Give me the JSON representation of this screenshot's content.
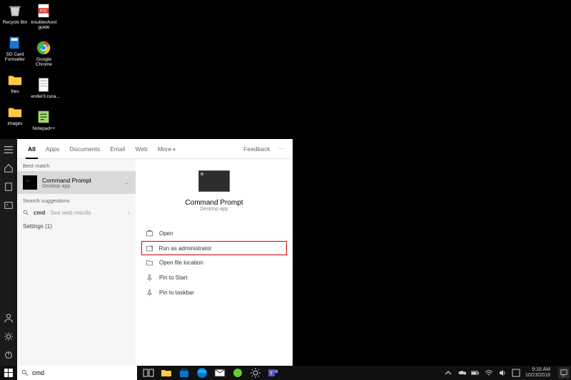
{
  "desktop_icons": [
    [
      {
        "name": "recycle-bin",
        "label": "Recycle Bin",
        "icon": "bin"
      },
      {
        "name": "sd-card-formatter",
        "label": "SD Card Formatter",
        "icon": "sd"
      },
      {
        "name": "files",
        "label": "files",
        "icon": "folder"
      },
      {
        "name": "images",
        "label": "images",
        "icon": "folder"
      }
    ],
    [
      {
        "name": "troubleshoot-guide",
        "label": "troubleshoot guide",
        "icon": "pdf"
      },
      {
        "name": "google-chrome",
        "label": "Google Chrome",
        "icon": "chrome"
      },
      {
        "name": "ender3-cura",
        "label": "ender3.cura...",
        "icon": "sheet"
      },
      {
        "name": "notepad-pp",
        "label": "Notepad++",
        "icon": "npp"
      }
    ]
  ],
  "search": {
    "tabs": [
      "All",
      "Apps",
      "Documents",
      "Email",
      "Web",
      "More"
    ],
    "active_tab": "All",
    "feedback": "Feedback",
    "best_match_label": "Best match",
    "best_match": {
      "title": "Command Prompt",
      "subtitle": "Desktop app"
    },
    "suggestions_label": "Search suggestions",
    "suggestions": [
      {
        "term": "cmd",
        "hint": " - See web results"
      }
    ],
    "settings_label": "Settings (1)",
    "preview": {
      "title": "Command Prompt",
      "subtitle": "Desktop app"
    },
    "actions": [
      {
        "name": "open",
        "label": "Open",
        "icon": "open"
      },
      {
        "name": "run-admin",
        "label": "Run as administrator",
        "icon": "admin",
        "highlight": true
      },
      {
        "name": "open-file-location",
        "label": "Open file location",
        "icon": "folder"
      },
      {
        "name": "pin-start",
        "label": "Pin to Start",
        "icon": "pin"
      },
      {
        "name": "pin-taskbar",
        "label": "Pin to taskbar",
        "icon": "pin"
      }
    ],
    "query": "cmd"
  },
  "taskbar": {
    "apps": [
      "task-view",
      "file-explorer",
      "store",
      "edge",
      "mail",
      "app-green",
      "settings",
      "teams"
    ],
    "tray": [
      "tray-up",
      "onedrive",
      "battery",
      "wifi",
      "volume",
      "ime"
    ],
    "time": "9:16 AM",
    "date": "10/23/2018"
  }
}
